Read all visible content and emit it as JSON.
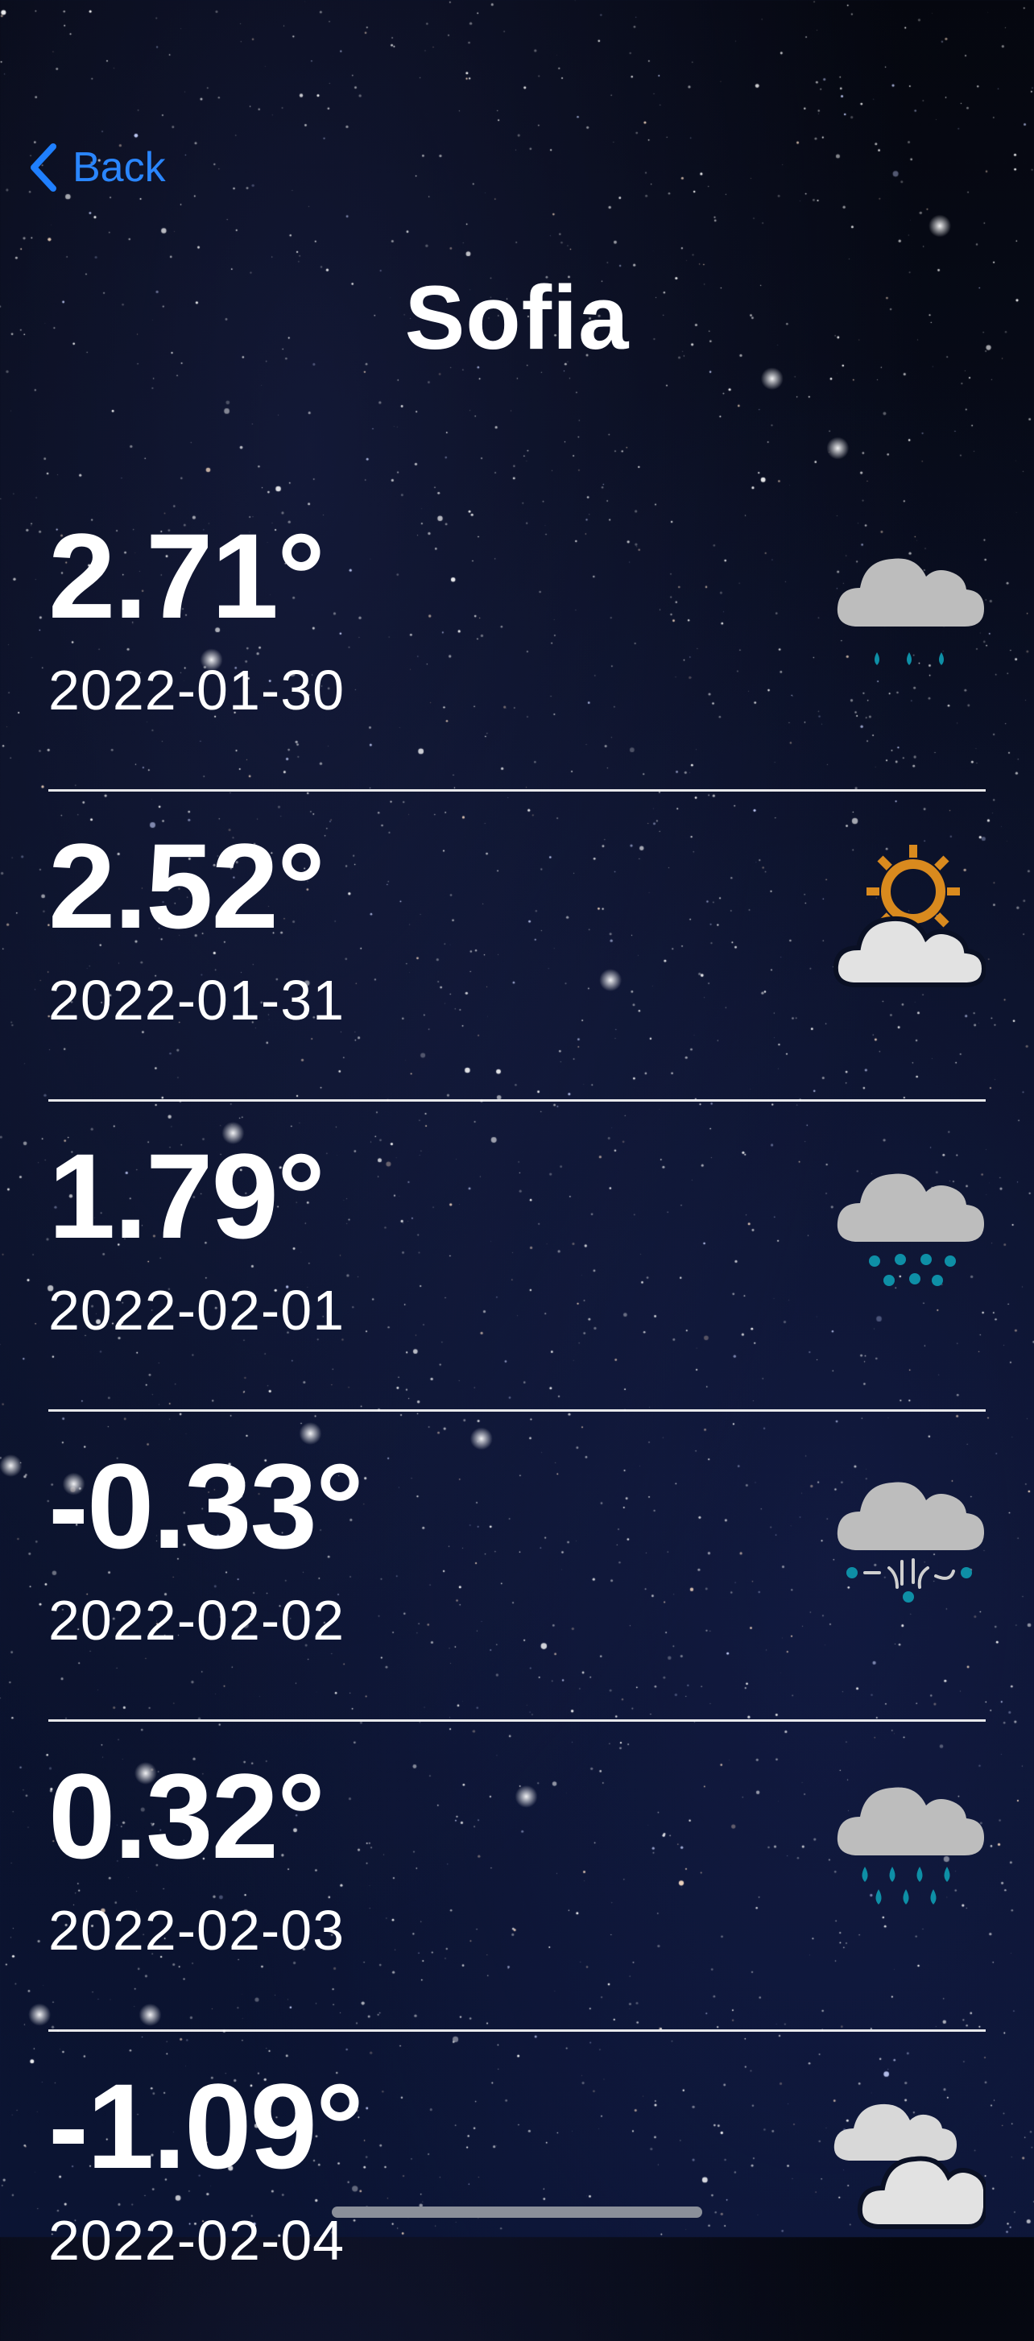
{
  "nav": {
    "back_label": "Back",
    "back_icon": "chevron-left-icon"
  },
  "city": "Sofia",
  "colors": {
    "accent": "#2a86ff",
    "cloud": "#bdbdbd",
    "rain": "#0e8fa6",
    "sun": "#d98a1e",
    "background": "#0a1024"
  },
  "forecast": [
    {
      "temp": "2.71°",
      "date": "2022-01-30",
      "icon": "rain-cloud-icon"
    },
    {
      "temp": "2.52°",
      "date": "2022-01-31",
      "icon": "partly-cloudy-icon"
    },
    {
      "temp": "1.79°",
      "date": "2022-02-01",
      "icon": "drizzle-cloud-icon"
    },
    {
      "temp": "-0.33°",
      "date": "2022-02-02",
      "icon": "freezing-rain-icon"
    },
    {
      "temp": "0.32°",
      "date": "2022-02-03",
      "icon": "heavy-rain-icon"
    },
    {
      "temp": "-1.09°",
      "date": "2022-02-04",
      "icon": "cloudy-icon"
    }
  ]
}
